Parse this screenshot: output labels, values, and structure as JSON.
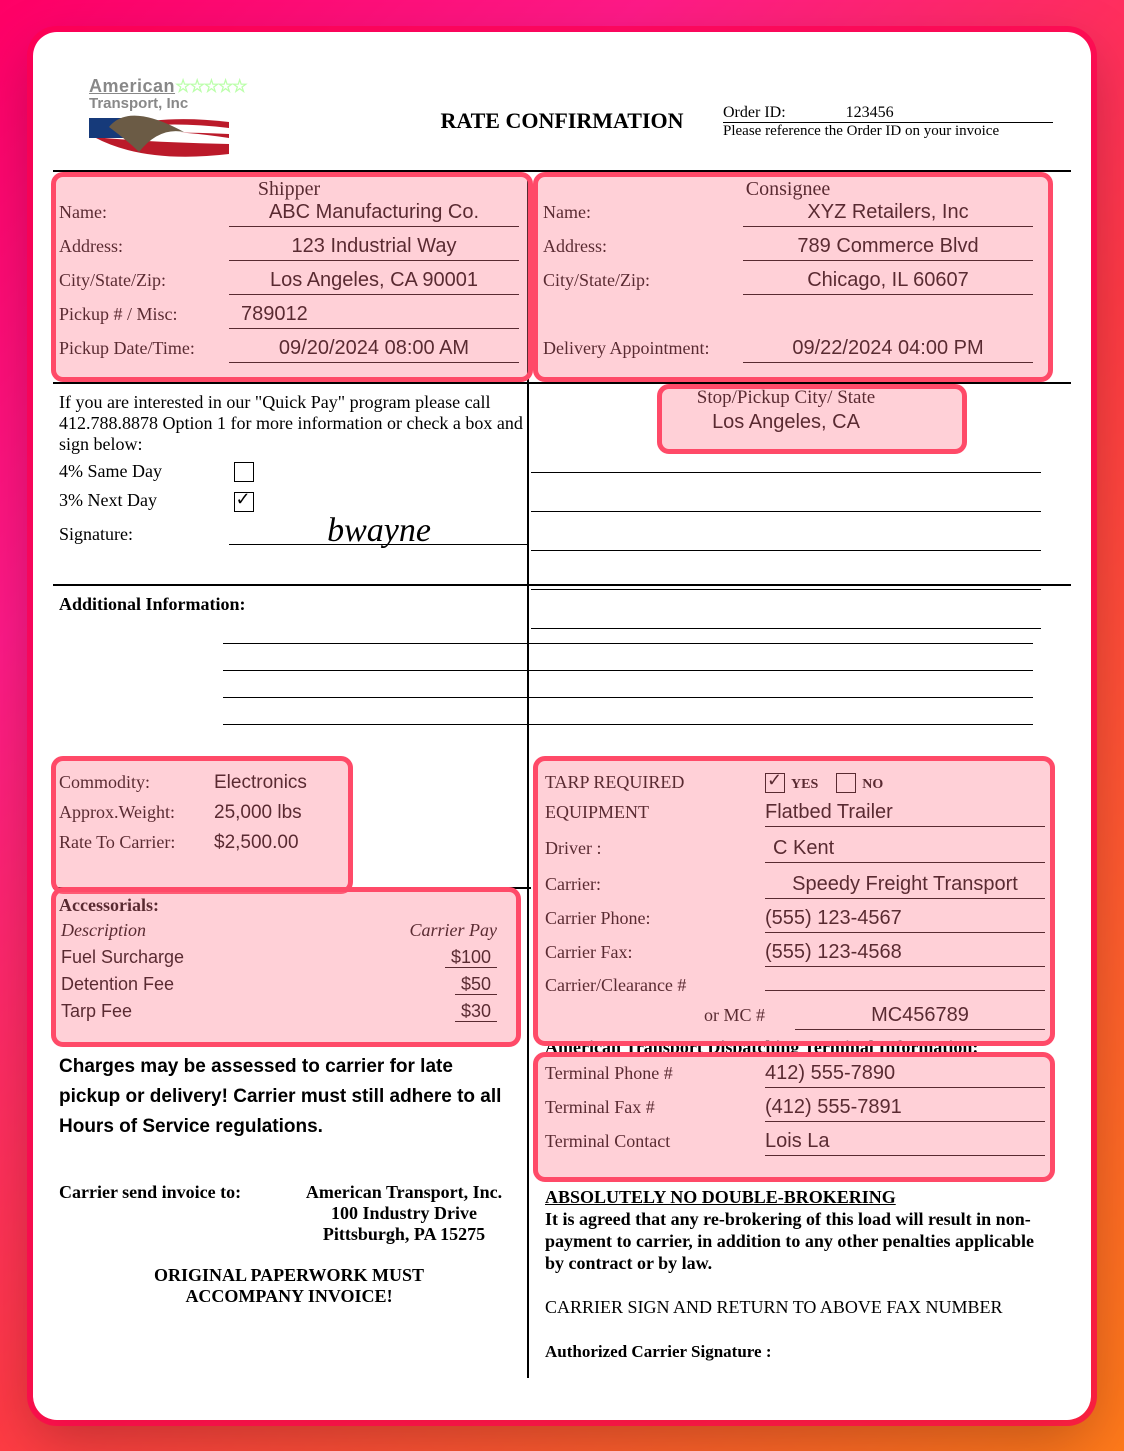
{
  "title": "RATE CONFIRMATION",
  "logo": {
    "line1": "American",
    "stars": "☆☆☆☆☆",
    "line2": "Transport, Inc"
  },
  "order": {
    "label": "Order ID:",
    "id": "123456",
    "note": "Please reference the Order ID on your invoice"
  },
  "shipper": {
    "heading": "Shipper",
    "name_label": "Name:",
    "name": "ABC Manufacturing Co.",
    "address_label": "Address:",
    "address": "123 Industrial Way",
    "csz_label": "City/State/Zip:",
    "csz": "Los Angeles, CA 90001",
    "pickupnum_label": "Pickup # / Misc:",
    "pickupnum": "789012",
    "pickupdt_label": "Pickup Date/Time:",
    "pickupdt": "09/20/2024 08:00 AM"
  },
  "consignee": {
    "heading": "Consignee",
    "name_label": "Name:",
    "name": "XYZ Retailers, Inc",
    "address_label": "Address:",
    "address": "789 Commerce Blvd",
    "csz_label": "City/State/Zip:",
    "csz": "Chicago, IL 60607",
    "deliv_label": "Delivery Appointment:",
    "deliv": "09/22/2024 04:00 PM"
  },
  "quickpay": {
    "text1": "If you are interested in our \"Quick Pay\" program please call",
    "text2": "412.788.8878 Option 1 for more information or check a box and sign below:",
    "opt1": "4% Same Day",
    "opt1_checked": false,
    "opt2": "3% Next Day",
    "opt2_checked": true,
    "sig_label": "Signature:",
    "signature": "bwayne"
  },
  "stops": {
    "heading": "Stop/Pickup  City/ State",
    "item1": "Los Angeles, CA"
  },
  "additional_label": "Additional Information:",
  "commodity": {
    "label": "Commodity:",
    "value": "Electronics",
    "wt_label": "Approx.Weight:",
    "wt": "25,000 lbs",
    "rate_label": "Rate To Carrier:",
    "rate": "$2,500.00"
  },
  "accessorials": {
    "heading": "Accessorials:",
    "col_desc": "Description",
    "col_pay": "Carrier Pay",
    "rows": [
      {
        "desc": "Fuel Surcharge",
        "pay": "$100"
      },
      {
        "desc": "Detention Fee",
        "pay": "$50"
      },
      {
        "desc": "Tarp Fee",
        "pay": "$30"
      }
    ]
  },
  "warning": "Charges may be assessed to carrier for late pickup or delivery!  Carrier must still adhere to all Hours of Service regulations.",
  "invoice": {
    "label": "Carrier send invoice to:",
    "line1": "American Transport, Inc.",
    "line2": "100 Industry Drive",
    "line3": "Pittsburgh, PA 15275",
    "paperwork1": "ORIGINAL PAPERWORK MUST",
    "paperwork2": "ACCOMPANY INVOICE!"
  },
  "right": {
    "tarp_label": "TARP REQUIRED",
    "tarp_yes": "YES",
    "tarp_no": "NO",
    "tarp_yes_checked": true,
    "tarp_no_checked": false,
    "equip_label": "EQUIPMENT",
    "equip": "Flatbed Trailer",
    "driver_label": "Driver :",
    "driver": "C Kent",
    "carrier_label": "Carrier:",
    "carrier": "Speedy Freight Transport",
    "cphone_label": "Carrier Phone:",
    "cphone": "(555) 123-4567",
    "cfax_label": "Carrier Fax:",
    "cfax": "(555) 123-4568",
    "clear_label": "Carrier/Clearance #",
    "mc_label": "or MC #",
    "mc": "MC456789"
  },
  "terminal": {
    "heading": "American Transport Dispatching Terminal Information:",
    "phone_label": "Terminal Phone #",
    "phone": "412) 555-7890",
    "fax_label": "Terminal Fax #",
    "fax": "(412) 555-7891",
    "contact_label": "Terminal Contact",
    "contact": "Lois La"
  },
  "nobroker": {
    "heading": "ABSOLUTELY NO DOUBLE-BROKERING",
    "text": "It is agreed that any re-brokering of this load will result in non-payment to carrier, in addition to any other penalties applicable by contract or by law."
  },
  "signreturn": "CARRIER SIGN AND RETURN TO ABOVE FAX NUMBER",
  "authsig_label": "Authorized Carrier  Signature :"
}
